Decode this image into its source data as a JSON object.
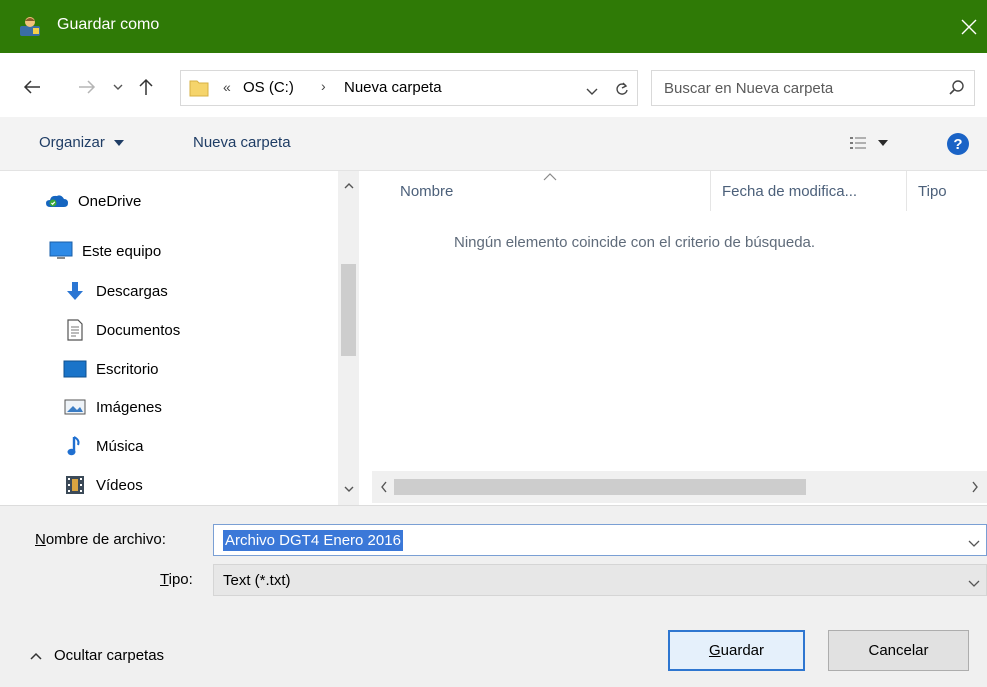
{
  "window": {
    "title": "Guardar como",
    "accent_color": "#2f7a06"
  },
  "address": {
    "overflow_glyph": "«",
    "crumbs": [
      "OS (C:)",
      "Nueva carpeta"
    ],
    "separator": "›"
  },
  "search": {
    "placeholder": "Buscar en Nueva carpeta"
  },
  "toolbar": {
    "organize_label": "Organizar",
    "new_folder_label": "Nueva carpeta",
    "help_label": "?"
  },
  "navpane": {
    "items": [
      {
        "label": "OneDrive",
        "icon": "onedrive-icon"
      },
      {
        "label": "Este equipo",
        "icon": "computer-icon"
      },
      {
        "label": "Descargas",
        "icon": "downloads-icon"
      },
      {
        "label": "Documentos",
        "icon": "documents-icon"
      },
      {
        "label": "Escritorio",
        "icon": "desktop-icon"
      },
      {
        "label": "Imágenes",
        "icon": "pictures-icon"
      },
      {
        "label": "Música",
        "icon": "music-icon"
      },
      {
        "label": "Vídeos",
        "icon": "videos-icon"
      }
    ]
  },
  "filelist": {
    "columns": [
      "Nombre",
      "Fecha de modifica...",
      "Tipo"
    ],
    "empty_message": "Ningún elemento coincide con el criterio de búsqueda."
  },
  "form": {
    "filename_label_accel": "N",
    "filename_label_rest": "ombre de archivo:",
    "filename_value": "Archivo DGT4 Enero 2016",
    "type_label_accel": "T",
    "type_label_rest": "ipo:",
    "type_value": "Text (*.txt)"
  },
  "footer": {
    "hide_folders_label": "Ocultar carpetas",
    "save_accel": "G",
    "save_rest": "uardar",
    "cancel_label": "Cancelar"
  }
}
